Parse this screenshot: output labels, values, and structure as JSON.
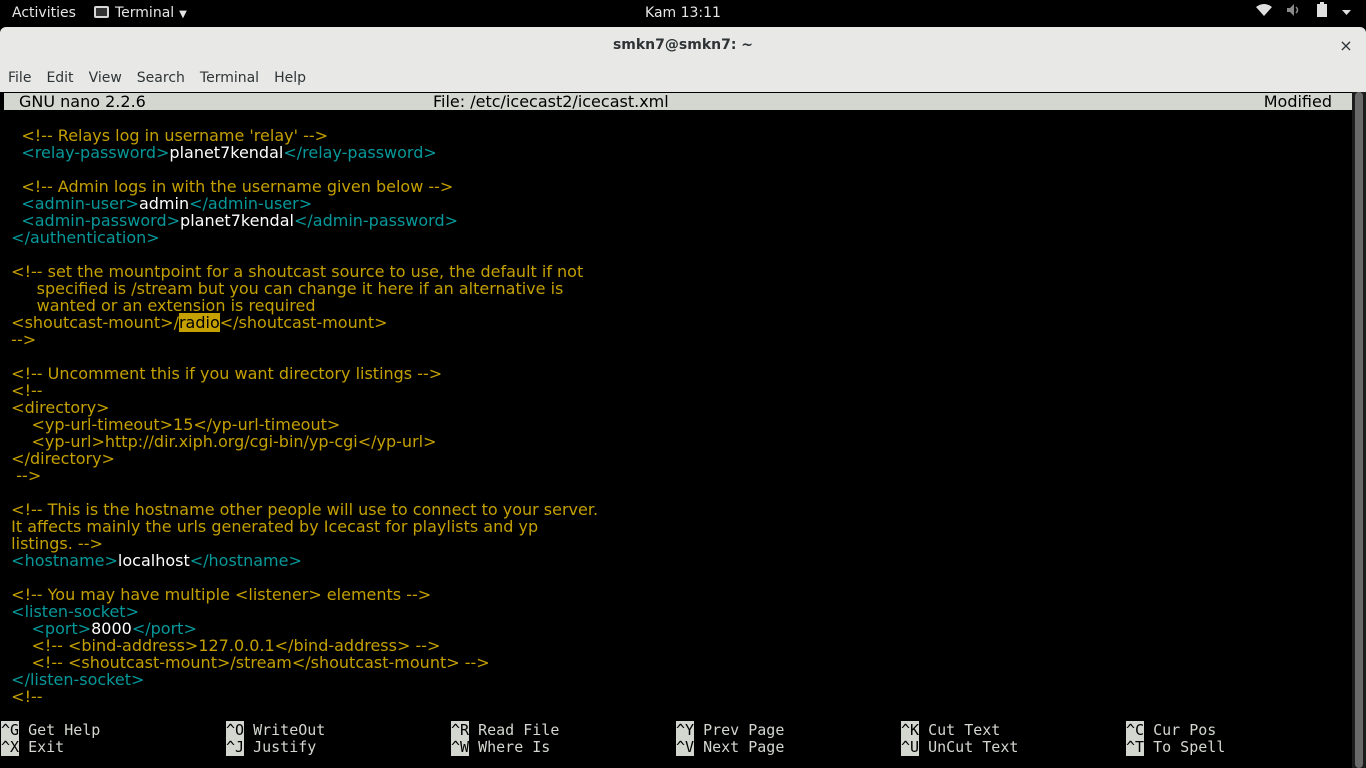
{
  "topbar": {
    "activities": "Activities",
    "app_menu": "Terminal",
    "clock": "Kam 13:11"
  },
  "window": {
    "title": "smkn7@smkn7: ~",
    "close": "×"
  },
  "menubar": [
    "File",
    "Edit",
    "View",
    "Search",
    "Terminal",
    "Help"
  ],
  "nano": {
    "version": "GNU nano 2.2.6",
    "file": "File: /etc/icecast2/icecast.xml",
    "status": "Modified"
  },
  "lines": [
    [
      "    ",
      "<!-- Relays log in username 'relay' -->",
      "",
      "",
      ""
    ],
    [
      "    ",
      "<relay-password>",
      "planet7kendal",
      "</relay-password>",
      ""
    ],
    [
      "",
      "",
      "",
      "",
      ""
    ],
    [
      "    ",
      "<!-- Admin logs in with the username given below -->",
      "",
      "",
      ""
    ],
    [
      "    ",
      "<admin-user>",
      "admin",
      "</admin-user>",
      ""
    ],
    [
      "    ",
      "<admin-password>",
      "planet7kendal",
      "</admin-password>",
      ""
    ],
    [
      "  ",
      "</authentication>",
      "",
      "",
      ""
    ],
    [
      "",
      "",
      "",
      "",
      ""
    ],
    [
      "  ",
      "<!-- set the mountpoint for a shoutcast source to use, the default if not",
      "",
      "",
      ""
    ],
    [
      "       ",
      "specified is /stream but you can change it here if an alternative is",
      "",
      "",
      ""
    ],
    [
      "       ",
      "wanted or an extension is required",
      "",
      "",
      ""
    ],
    [
      "  ",
      "<shoutcast-mount>/",
      "radio",
      "<",
      "/shoutcast-mount>"
    ],
    [
      "  ",
      "-->",
      "",
      "",
      ""
    ],
    [
      "",
      "",
      "",
      "",
      ""
    ],
    [
      "  ",
      "<!-- Uncomment this if you want directory listings -->",
      "",
      "",
      ""
    ],
    [
      "  ",
      "<!--",
      "",
      "",
      ""
    ],
    [
      "  ",
      "<directory>",
      "",
      "",
      ""
    ],
    [
      "      ",
      "<yp-url-timeout>15</yp-url-timeout>",
      "",
      "",
      ""
    ],
    [
      "      ",
      "<yp-url>http://dir.xiph.org/cgi-bin/yp-cgi</yp-url>",
      "",
      "",
      ""
    ],
    [
      "  ",
      "</directory>",
      "",
      "",
      ""
    ],
    [
      "   ",
      "-->",
      "",
      "",
      ""
    ],
    [
      "",
      "",
      "",
      "",
      ""
    ],
    [
      "  ",
      "<!-- This is the hostname other people will use to connect to your server.",
      "",
      "",
      ""
    ],
    [
      "  ",
      "It affects mainly the urls generated by Icecast for playlists and yp",
      "",
      "",
      ""
    ],
    [
      "  ",
      "listings. -->",
      "",
      "",
      ""
    ],
    [
      "  ",
      "<hostname>",
      "localhost",
      "</hostname>",
      ""
    ],
    [
      "",
      "",
      "",
      "",
      ""
    ],
    [
      "  ",
      "<!-- You may have multiple <listener> elements -->",
      "",
      "",
      ""
    ],
    [
      "  ",
      "<listen-socket>",
      "",
      "",
      ""
    ],
    [
      "      ",
      "<port>",
      "8000",
      "</port>",
      ""
    ],
    [
      "      ",
      "<!-- <bind-address>127.0.0.1</bind-address> -->",
      "",
      "",
      ""
    ],
    [
      "      ",
      "<!-- <shoutcast-mount>/stream</shoutcast-mount> -->",
      "",
      "",
      ""
    ],
    [
      "  ",
      "</listen-socket>",
      "",
      "",
      ""
    ],
    [
      "  ",
      "<!--",
      "",
      "",
      ""
    ]
  ],
  "shortcuts": [
    {
      "key": "^G",
      "label": "Get Help"
    },
    {
      "key": "^X",
      "label": "Exit"
    },
    {
      "key": "^O",
      "label": "WriteOut"
    },
    {
      "key": "^J",
      "label": "Justify"
    },
    {
      "key": "^R",
      "label": "Read File"
    },
    {
      "key": "^W",
      "label": "Where Is"
    },
    {
      "key": "^Y",
      "label": "Prev Page"
    },
    {
      "key": "^V",
      "label": "Next Page"
    },
    {
      "key": "^K",
      "label": "Cut Text"
    },
    {
      "key": "^U",
      "label": "UnCut Text"
    },
    {
      "key": "^C",
      "label": "Cur Pos"
    },
    {
      "key": "^T",
      "label": "To Spell"
    }
  ],
  "colors": {
    "comment": "#c4a000",
    "tag": "#06989a",
    "value": "#ffffff",
    "highlight": "#c4a000",
    "header_bg": "#d3d7cf"
  },
  "icons": [
    "wifi-icon",
    "volume-icon",
    "battery-icon",
    "power-icon",
    "terminal-icon"
  ]
}
